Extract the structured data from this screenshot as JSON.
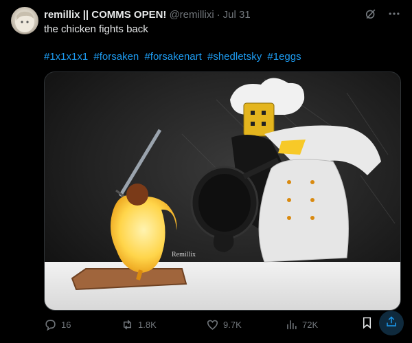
{
  "author": {
    "name": "remillix || COMMS OPEN!",
    "handle": "@remillixi",
    "date": "Jul 31"
  },
  "tweet": {
    "text": "the chicken fights back",
    "hashtags": [
      "#1x1x1x1",
      "#forsaken",
      "#forsakenart",
      "#shedletsky",
      "#1eggs"
    ]
  },
  "media": {
    "signature": "Remillix"
  },
  "actions": {
    "replies": "16",
    "reposts": "1.8K",
    "likes": "9.7K",
    "views": "72K"
  },
  "icons": {
    "grok": "grok-icon",
    "more": "more-icon",
    "reply": "reply-icon",
    "repost": "repost-icon",
    "like": "heart-icon",
    "views": "views-icon",
    "bookmark": "bookmark-icon",
    "share": "share-icon"
  },
  "colors": {
    "background": "#000000",
    "text": "#e7e9ea",
    "muted": "#71767b",
    "accent": "#1d9bf0"
  }
}
